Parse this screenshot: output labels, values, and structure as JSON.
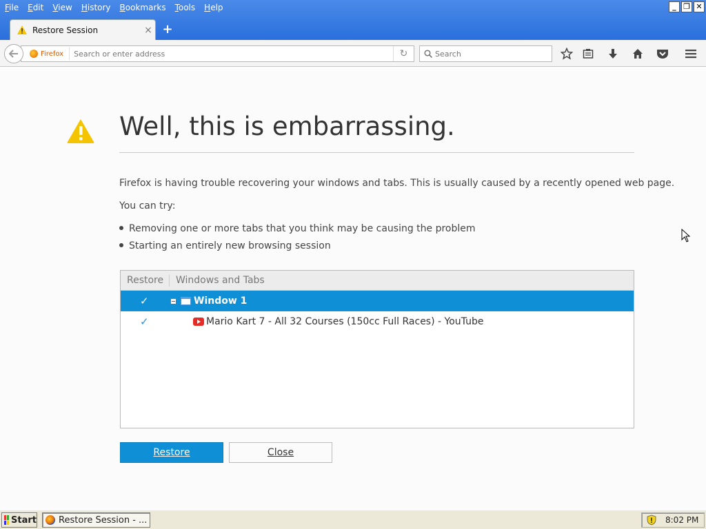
{
  "menu": {
    "items": [
      {
        "label": "File",
        "key": "F",
        "rest": "ile"
      },
      {
        "label": "Edit",
        "key": "E",
        "rest": "dit"
      },
      {
        "label": "View",
        "key": "V",
        "rest": "iew"
      },
      {
        "label": "History",
        "key": "H",
        "rest": "istory"
      },
      {
        "label": "Bookmarks",
        "key": "B",
        "rest": "ookmarks"
      },
      {
        "label": "Tools",
        "key": "T",
        "rest": "ools"
      },
      {
        "label": "Help",
        "key": "H",
        "rest": "elp"
      }
    ]
  },
  "window_controls": {
    "minimize": "_",
    "restore": "❐",
    "close": "✕"
  },
  "tab": {
    "title": "Restore Session",
    "close": "×",
    "icon": "warning-icon"
  },
  "new_tab": "+",
  "urlbar": {
    "identity_label": "Firefox",
    "placeholder": "Search or enter address",
    "reload": "↻"
  },
  "search": {
    "placeholder": "Search"
  },
  "page": {
    "heading": "Well, this is embarrassing.",
    "description": "Firefox is having trouble recovering your windows and tabs. This is usually caused by a recently opened web page.",
    "try_label": "You can try:",
    "bullets": [
      "Removing one or more tabs that you think may be causing the problem",
      "Starting an entirely new browsing session"
    ],
    "tree": {
      "col_restore": "Restore",
      "col_tabs": "Windows and Tabs",
      "rows": [
        {
          "type": "window",
          "checked": "✓",
          "twisty": "−",
          "label": "Window 1"
        },
        {
          "type": "tab",
          "checked": "✓",
          "label": "Mario Kart 7 - All 32 Courses (150cc Full Races) - YouTube"
        }
      ]
    },
    "buttons": {
      "restore_key": "R",
      "restore_rest": "estore",
      "close_key": "C",
      "close_rest": "lose"
    }
  },
  "taskbar": {
    "start_label": "Start",
    "task_label": "Restore Session - ...",
    "clock": "8:02 PM"
  },
  "colors": {
    "accent": "#0f8fd6",
    "warning": "#f5c400",
    "titlebar": "#2a6fdc"
  }
}
